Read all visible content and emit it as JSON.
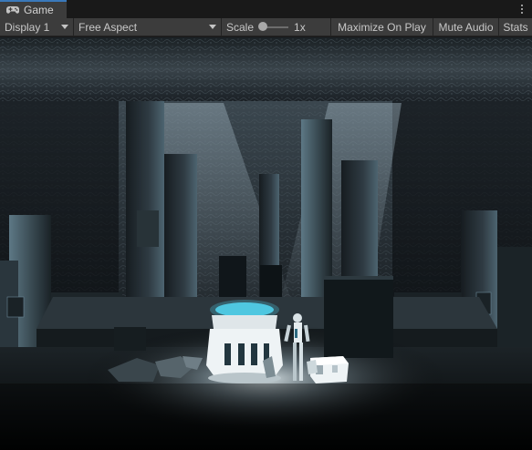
{
  "window": {
    "tab_title": "Game",
    "tab_icon": "gamepad-icon",
    "menu_icon": "kebab-menu-icon"
  },
  "toolbar": {
    "display_label": "Display 1",
    "aspect_label": "Free Aspect",
    "scale_label": "Scale",
    "scale_value": "1x",
    "scale_level": 0,
    "maximize_label": "Maximize On Play",
    "mute_label": "Mute Audio",
    "stats_label": "Stats"
  },
  "colors": {
    "background": "#191919",
    "toolbar": "#3c3c3c",
    "active_tab_accent": "#3a79bb",
    "text": "#c8c8c8",
    "scene_glow": "#4fc8e0"
  }
}
